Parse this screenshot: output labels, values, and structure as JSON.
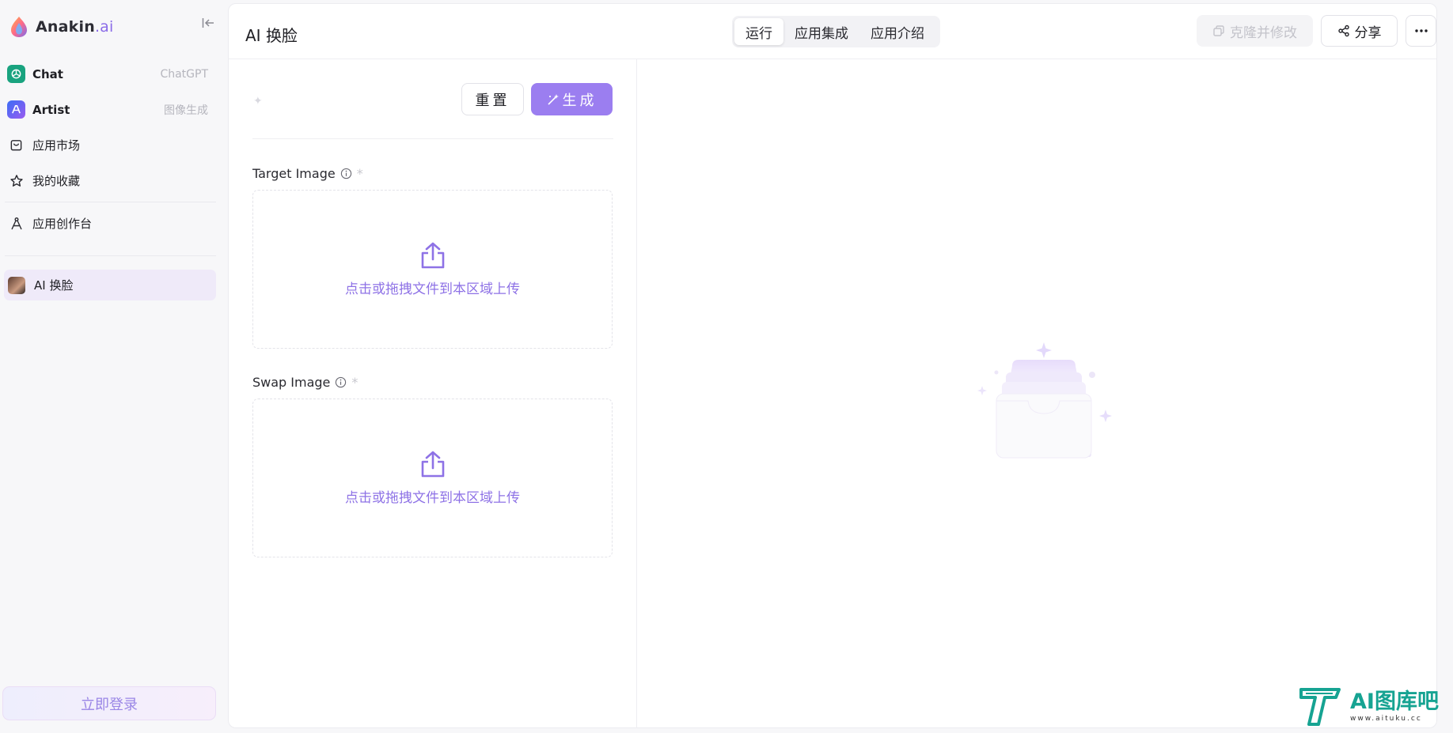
{
  "brand": {
    "name": "Anakin",
    "suffix": ".ai"
  },
  "sidebar": {
    "items": [
      {
        "label": "Chat",
        "sub": "ChatGPT",
        "icon": "chatgpt-icon"
      },
      {
        "label": "Artist",
        "sub": "图像生成",
        "icon": "artist-icon"
      },
      {
        "label": "应用市场",
        "icon": "store-icon"
      },
      {
        "label": "我的收藏",
        "icon": "star-icon"
      },
      {
        "label": "应用创作台",
        "icon": "compass-icon"
      }
    ],
    "recent": [
      {
        "label": "AI 换脸",
        "icon": "app-avatar"
      }
    ],
    "login_label": "立即登录"
  },
  "header": {
    "title": "AI 换脸",
    "tabs": [
      {
        "label": "运行",
        "active": true
      },
      {
        "label": "应用集成",
        "active": false
      },
      {
        "label": "应用介绍",
        "active": false
      }
    ],
    "clone_label": "克隆并修改",
    "share_label": "分享"
  },
  "form": {
    "reset_label": "重置",
    "generate_label": "生成",
    "fields": [
      {
        "label": "Target Image",
        "required_mark": "*",
        "dropzone_text": "点击或拖拽文件到本区域上传"
      },
      {
        "label": "Swap Image",
        "required_mark": "*",
        "dropzone_text": "点击或拖拽文件到本区域上传"
      }
    ]
  },
  "watermark": {
    "title": "AI图库吧",
    "url": "www.aituku.cc"
  },
  "colors": {
    "accent": "#9b7ef0",
    "accent_text": "#8e72e6",
    "watermark": "#16a392"
  }
}
